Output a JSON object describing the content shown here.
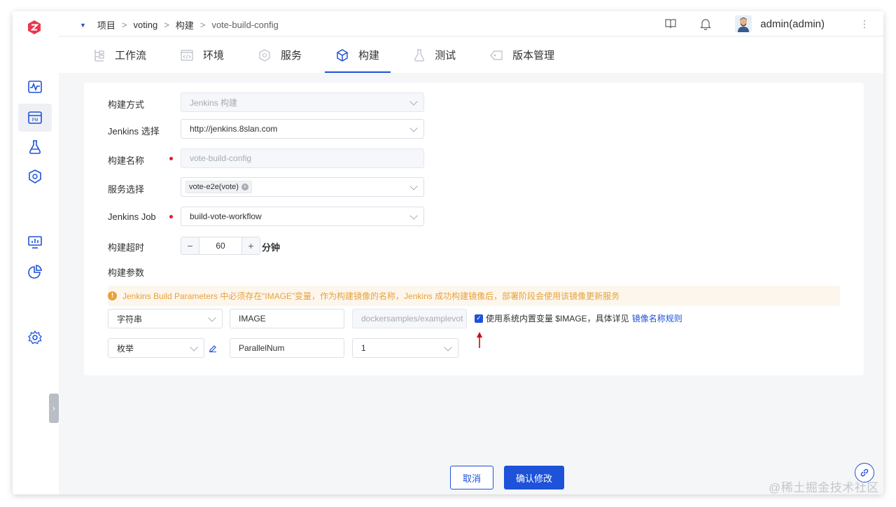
{
  "breadcrumb": {
    "items": [
      "项目",
      "voting",
      "构建",
      "vote-build-config"
    ],
    "separator": ">"
  },
  "user": {
    "name": "admin(admin)"
  },
  "tabs": [
    {
      "label": "工作流",
      "icon": "workflow-icon"
    },
    {
      "label": "环境",
      "icon": "environment-icon"
    },
    {
      "label": "服务",
      "icon": "service-icon"
    },
    {
      "label": "构建",
      "icon": "build-icon",
      "active": true
    },
    {
      "label": "测试",
      "icon": "test-icon"
    },
    {
      "label": "版本管理",
      "icon": "version-icon"
    }
  ],
  "form": {
    "build_method": {
      "label": "构建方式",
      "value": "Jenkins 构建"
    },
    "jenkins_select": {
      "label": "Jenkins 选择",
      "value": "http://jenkins.8slan.com"
    },
    "build_name": {
      "label": "构建名称",
      "value": "vote-build-config"
    },
    "service_select": {
      "label": "服务选择",
      "chip": "vote-e2e(vote)"
    },
    "jenkins_job": {
      "label": "Jenkins Job",
      "value": "build-vote-workflow"
    },
    "timeout": {
      "label": "构建超时",
      "minus": "−",
      "value": "60",
      "plus": "+",
      "unit": "分钟"
    },
    "params_label": "构建参数"
  },
  "alert": {
    "icon": "!",
    "text": "Jenkins Build Parameters 中必须存在“IMAGE”变量，作为构建镜像的名称，Jenkins 成功构建镜像后，部署阶段会使用该镜像更新服务"
  },
  "params": [
    {
      "type": "字符串",
      "name": "IMAGE",
      "value": "dockersamples/examplevot"
    },
    {
      "type": "枚举",
      "name": "ParallelNum",
      "value": "1"
    }
  ],
  "builtin_var": {
    "checked": true,
    "text": "使用系统内置变量 $IMAGE，具体详见",
    "link": "镜像名称规则"
  },
  "buttons": {
    "cancel": "取消",
    "confirm": "确认修改"
  },
  "watermark": "@稀土掘金技术社区",
  "colors": {
    "primary": "#1d52d9",
    "warning": "#e6a23c",
    "required": "#e02020",
    "logo": "#e8384f"
  }
}
